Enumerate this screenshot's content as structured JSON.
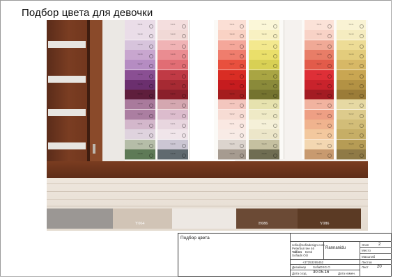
{
  "page": {
    "title": "Подбор цвета для девочки"
  },
  "colors": {
    "door": "#6b321b",
    "skirting": "#6a321b",
    "floor": "#e8dfd5"
  },
  "palette_left_a": [
    "#eadde8",
    "#eadde8",
    "#d7c4dc",
    "#c8a6cf",
    "#b58cc2",
    "#8a4f93",
    "#6b2f6e",
    "#5f1e3c",
    "#a97a9c",
    "#ab7ea1",
    "#d3b7cb",
    "#dfd3de",
    "#b5bda8",
    "#5e7a56"
  ],
  "palette_left_b": [
    "#f4dede",
    "#f1d9d6",
    "#f0b3b5",
    "#ea8c91",
    "#e16d74",
    "#c03a45",
    "#a62a33",
    "#8a1f2b",
    "#d4a7b0",
    "#dcbccd",
    "#e8d6df",
    "#f0e5ea",
    "#cbc6d3",
    "#606a6f"
  ],
  "palette_mid_a": [
    "#fbdfd5",
    "#f9d2c4",
    "#f4a79a",
    "#ef7d6d",
    "#e8503e",
    "#d92d24",
    "#c61c1f",
    "#a51d1e",
    "#f3c6be",
    "#f7dcd4",
    "#fae8e2",
    "#f8ebe6",
    "#dcd4ce",
    "#a69b90"
  ],
  "palette_mid_b": [
    "#fbf7d8",
    "#f8f1c2",
    "#f3e88e",
    "#eadf6a",
    "#d8d054",
    "#a9a543",
    "#8a8a3a",
    "#74732f",
    "#e6e2ae",
    "#efeac6",
    "#f5f0d8",
    "#ece6c9",
    "#c5c0a0",
    "#6f6d52"
  ],
  "palette_right_a": [
    "#fbe2d8",
    "#f8d2c6",
    "#f0a996",
    "#e87d67",
    "#e25b4a",
    "#de2f37",
    "#c9232c",
    "#a31b23",
    "#f1b39f",
    "#ee9f84",
    "#f0b38e",
    "#f3c89e",
    "#f3d7b1",
    "#c89a6f"
  ],
  "palette_right_b": [
    "#f9f3d4",
    "#f5ecc0",
    "#eddc96",
    "#e3cc7c",
    "#d7b866",
    "#c9a652",
    "#b39244",
    "#9b7c38",
    "#e6d9a3",
    "#ddcb8c",
    "#d2bd78",
    "#c6ae66",
    "#b69c55",
    "#8f7a46"
  ],
  "swatch_codes": [
    "S141",
    "S140",
    "S139",
    "S138",
    "S137",
    "S136",
    "S135",
    "S134",
    "S133",
    "S132",
    "S131",
    "S130",
    "S129",
    "S128"
  ],
  "chips": [
    {
      "label": "",
      "color": "#9b9794"
    },
    {
      "label": "Y064",
      "color": "#d1c4b6"
    },
    {
      "label": "",
      "color": "#ede8e3"
    },
    {
      "label": "H086",
      "color": "#6b4a35"
    },
    {
      "label": "Y086",
      "color": "#5b3a24"
    }
  ],
  "stamp": {
    "title": "Подбор цвета",
    "contact_email": "sofia@sofiadesign.com",
    "contact_address": "Peterburi tee 46",
    "contact_city": "Tallinn",
    "contact_country": "Eesti",
    "contact_site": "Sofiads OÜ",
    "phone": "+37253265452",
    "company_short": "Rannanidu",
    "designer_label": "Дизайнер",
    "designer_name": "SofiaDSG.O",
    "date_label": "Дата созд.",
    "date_value": "30.05.16",
    "date_change_label": "Дата измен.",
    "stage_label": "Этап",
    "stage_value": "2",
    "place_label": "Место",
    "scale_label": "Масштаб",
    "sheets_label": "Листов",
    "sheet_label": "Лист",
    "sheet_value": "20"
  }
}
